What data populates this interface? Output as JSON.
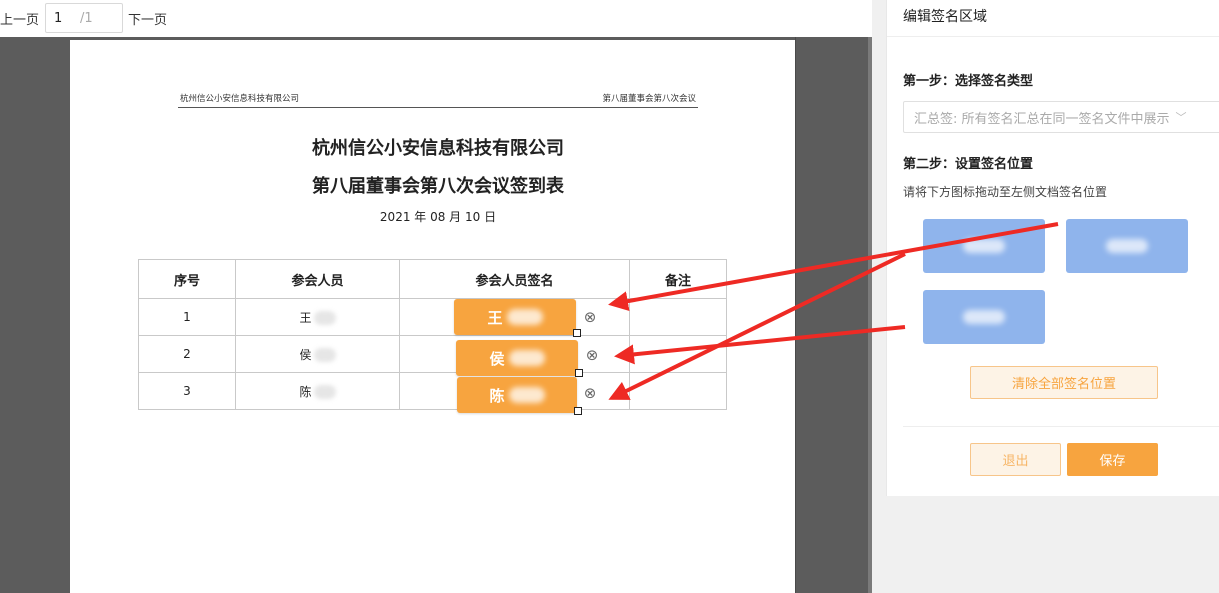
{
  "pager": {
    "prev_label": "上一页",
    "current_page": "1",
    "total_pages": "/1",
    "next_label": "下一页"
  },
  "document": {
    "header_left": "杭州信公小安信息科技有限公司",
    "header_right": "第八届董事会第八次会议",
    "title_line1": "杭州信公小安信息科技有限公司",
    "title_line2": "第八届董事会第八次会议签到表",
    "date": "2021 年 08 月 10 日",
    "table": {
      "headers": [
        "序号",
        "参会人员",
        "参会人员签名",
        "备注"
      ],
      "rows": [
        {
          "no": "1",
          "name": "王"
        },
        {
          "no": "2",
          "name": "侯"
        },
        {
          "no": "3",
          "name": "陈"
        }
      ]
    },
    "placed_signatures": [
      {
        "label": "王"
      },
      {
        "label": "侯"
      },
      {
        "label": "陈"
      }
    ]
  },
  "panel": {
    "title": "编辑签名区域",
    "step1_label": "第一步：选择签名类型",
    "sign_type_value": "汇总签: 所有签名汇总在同一签名文件中展示",
    "step2_label": "第二步：设置签名位置",
    "step2_hint": "请将下方图标拖动至左侧文档签名位置",
    "clear_all_label": "清除全部签名位置",
    "exit_label": "退出",
    "save_label": "保存"
  },
  "colors": {
    "accent": "#f7a43f",
    "drag_item": "#8fb4ec",
    "arrow": "#ee2a24",
    "viewer_bg": "#5c5c5c"
  },
  "icons": {
    "delete": "circle-x-icon",
    "dropdown": "chevron-down-icon"
  }
}
